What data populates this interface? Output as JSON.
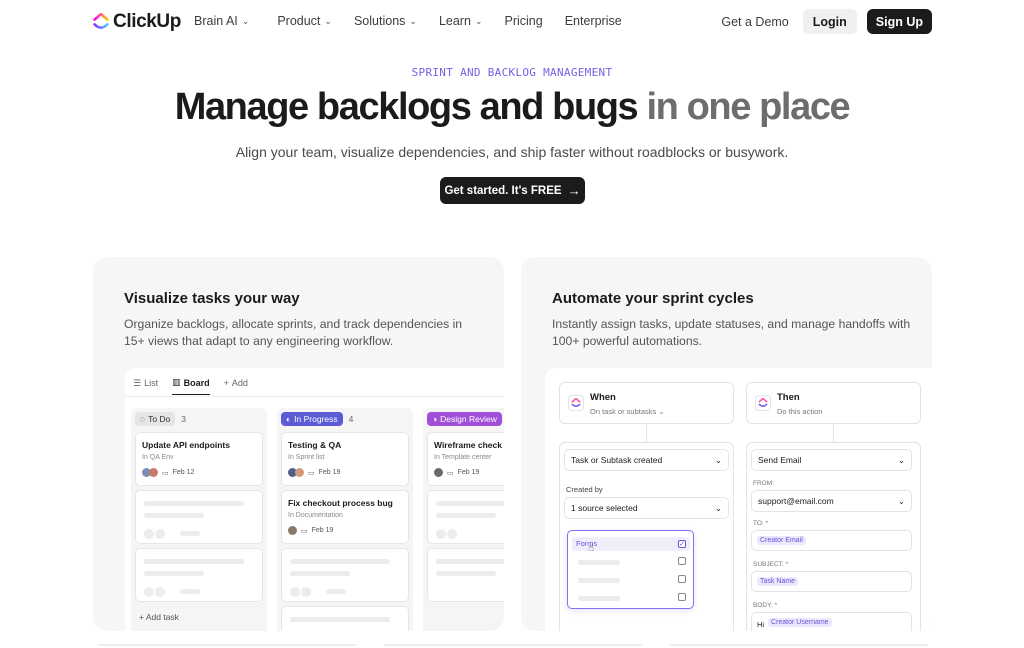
{
  "nav": {
    "brand": "ClickUp",
    "menu": [
      {
        "label": "Brain AI",
        "has_dropdown": true
      },
      {
        "label": "Product",
        "has_dropdown": true
      },
      {
        "label": "Solutions",
        "has_dropdown": true
      },
      {
        "label": "Learn",
        "has_dropdown": true
      },
      {
        "label": "Pricing",
        "has_dropdown": false
      },
      {
        "label": "Enterprise",
        "has_dropdown": false
      }
    ],
    "demo": "Get a Demo",
    "login": "Login",
    "signup": "Sign Up"
  },
  "hero": {
    "eyebrow": "SPRINT AND BACKLOG MANAGEMENT",
    "title_main": "Manage backlogs and bugs ",
    "title_muted": "in one place",
    "subtitle": "Align your team, visualize dependencies, and ship faster without roadblocks or busywork.",
    "cta": "Get started. It's FREE",
    "cta_arrow": "→"
  },
  "card_left": {
    "title": "Visualize tasks your way",
    "desc": "Organize backlogs, allocate sprints, and track dependencies in 15+ views that adapt to any engineering workflow.",
    "tabs": [
      "List",
      "Board",
      "Add"
    ],
    "columns": [
      {
        "status": "To Do",
        "count": "3",
        "tasks": [
          {
            "title": "Update API endpoints",
            "list": "In QA Env",
            "date": "Feb 12"
          }
        ],
        "add": "Add task"
      },
      {
        "status": "In Progress",
        "count": "4",
        "tasks": [
          {
            "title": "Testing & QA",
            "list": "In Sprint list",
            "date": "Feb 19"
          },
          {
            "title": "Fix checkout process bug",
            "list": "In Documentation",
            "date": "Feb 19"
          }
        ]
      },
      {
        "status": "Design Review",
        "count": "",
        "tasks": [
          {
            "title": "Wireframe check",
            "list": "In Template center",
            "date": "Feb 19"
          }
        ]
      }
    ]
  },
  "card_right": {
    "title": "Automate your sprint cycles",
    "desc": "Instantly assign tasks, update statuses, and manage handoffs with 100+ powerful automations.",
    "when": {
      "title": "When",
      "sub": "On task or subtasks"
    },
    "then": {
      "title": "Then",
      "sub": "Do this action"
    },
    "trigger": "Task or Subtask created",
    "created_by_label": "Created by",
    "source": "1 source selected",
    "dropdown_first": "Forms",
    "action": "Send Email",
    "from_label": "FROM:",
    "from_value": "support@email.com",
    "to_label": "TO: *",
    "to_tag": "Creator Email",
    "subject_label": "SUBJECT: *",
    "subject_tag": "Task Name",
    "body_label": "BODY: *",
    "body_prefix": "Hi",
    "body_tag": "Creator Username"
  },
  "colors": {
    "accent_purple": "#7b5ce8",
    "in_progress": "#5b5bd6",
    "design_review": "#a14fd8",
    "dark": "#1b1b1b"
  }
}
